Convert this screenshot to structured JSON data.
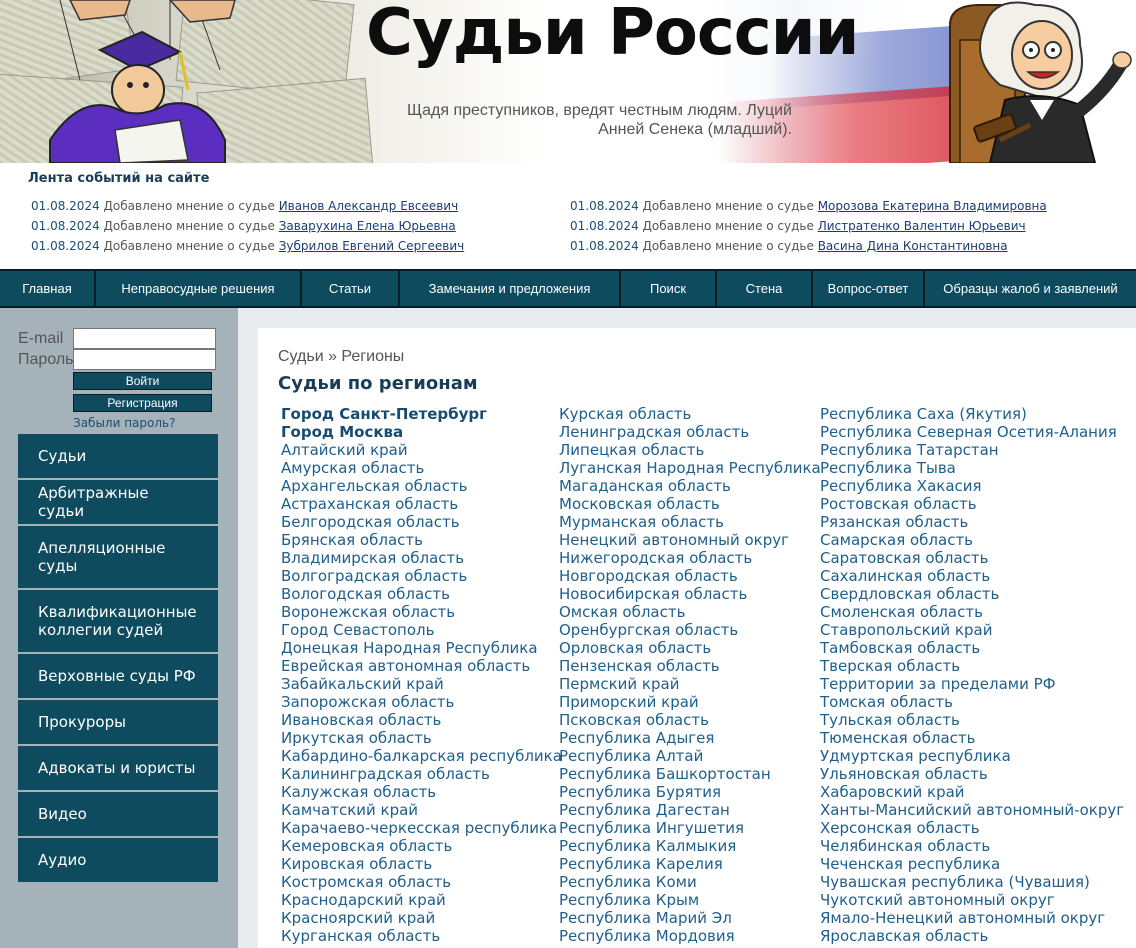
{
  "colors": {
    "accent": "#0e4b5f",
    "link": "#1e5f8c",
    "sidebar": "#a6b2ba",
    "title": "#1a3d57"
  },
  "header": {
    "title": "Судьи России",
    "quote_line1": "Щадя преступников, вредят честным людям. Луций",
    "quote_line2": "Анней Сенека (младший)."
  },
  "events": {
    "title": "Лента событий на сайте",
    "items": [
      {
        "date": "01.08.2024",
        "text": "Добавлено мнение о судье",
        "judge": "Иванов Александр Евсеевич"
      },
      {
        "date": "01.08.2024",
        "text": "Добавлено мнение о судье",
        "judge": "Заварухина Елена Юрьевна"
      },
      {
        "date": "01.08.2024",
        "text": "Добавлено мнение о судье",
        "judge": "Зубрилов Евгений Сергеевич"
      },
      {
        "date": "01.08.2024",
        "text": "Добавлено мнение о судье",
        "judge": "Морозова Екатерина Владимировна"
      },
      {
        "date": "01.08.2024",
        "text": "Добавлено мнение о судье",
        "judge": "Листратенко Валентин Юрьевич"
      },
      {
        "date": "01.08.2024",
        "text": "Добавлено мнение о судье",
        "judge": "Васина Дина Константиновна"
      }
    ]
  },
  "nav": [
    "Главная",
    "Неправосудные решения",
    "Статьи",
    "Замечания и предложения",
    "Поиск",
    "Стена",
    "Вопрос-ответ",
    "Образцы жалоб и заявлений"
  ],
  "login": {
    "email_label": "E-mail",
    "password_label": "Пароль",
    "email_value": "",
    "password_value": "",
    "login_button": "Войти",
    "register_button": "Регистрация",
    "forgot_link": "Забыли пароль?"
  },
  "sidebar_menu": [
    "Судьи",
    "Арбитражные судьи",
    "Апелляционные суды",
    "Квалификационные коллегии судей",
    "Верховные суды РФ",
    "Прокуроры",
    "Адвокаты и юристы",
    "Видео",
    "Аудио"
  ],
  "breadcrumb": "Судьи » Регионы",
  "page_title": "Судьи по регионам",
  "regions": {
    "col1": [
      "Город Санкт-Петербург",
      "Город Москва",
      "Алтайский край",
      "Амурская область",
      "Архангельская область",
      "Астраханская область",
      "Белгородская область",
      "Брянская область",
      "Владимирская область",
      "Волгоградская область",
      "Вологодская область",
      "Воронежская область",
      "Город Севастополь",
      "Донецкая Народная Республика",
      "Еврейская автономная область",
      "Забайкальский край",
      "Запорожская область",
      "Ивановская область",
      "Иркутская область",
      "Кабардино-балкарская республика",
      "Калининградская область",
      "Калужская область",
      "Камчатский край",
      "Карачаево-черкесская республика",
      "Кемеровская область",
      "Кировская область",
      "Костромская область",
      "Краснодарский край",
      "Красноярский край",
      "Курганская область"
    ],
    "col2": [
      "Курская область",
      "Ленинградская область",
      "Липецкая область",
      "Луганская Народная Республика",
      "Магаданская область",
      "Московская область",
      "Мурманская область",
      "Ненецкий автономный округ",
      "Нижегородская область",
      "Новгородская область",
      "Новосибирская область",
      "Омская область",
      "Оренбургская область",
      "Орловская область",
      "Пензенская область",
      "Пермский край",
      "Приморский край",
      "Псковская область",
      "Республика Адыгея",
      "Республика Алтай",
      "Республика Башкортостан",
      "Республика Бурятия",
      "Республика Дагестан",
      "Республика Ингушетия",
      "Республика Калмыкия",
      "Республика Карелия",
      "Республика Коми",
      "Республика Крым",
      "Республика Марий Эл",
      "Республика Мордовия"
    ],
    "col3": [
      "Республика Саха (Якутия)",
      "Республика Северная Осетия-Алания",
      "Республика Татарстан",
      "Республика Тыва",
      "Республика Хакасия",
      "Ростовская область",
      "Рязанская область",
      "Самарская область",
      "Саратовская область",
      "Сахалинская область",
      "Свердловская область",
      "Смоленская область",
      "Ставропольский край",
      "Тамбовская область",
      "Тверская область",
      "Территории за пределами РФ",
      "Томская область",
      "Тульская область",
      "Тюменская область",
      "Удмуртская республика",
      "Ульяновская область",
      "Хабаровский край",
      "Ханты-Мансийский автономный-округ",
      "Херсонская область",
      "Челябинская область",
      "Чеченская республика",
      "Чувашская республика (Чувашия)",
      "Чукотский автономный округ",
      "Ямало-Ненецкий автономный округ",
      "Ярославская область"
    ]
  }
}
